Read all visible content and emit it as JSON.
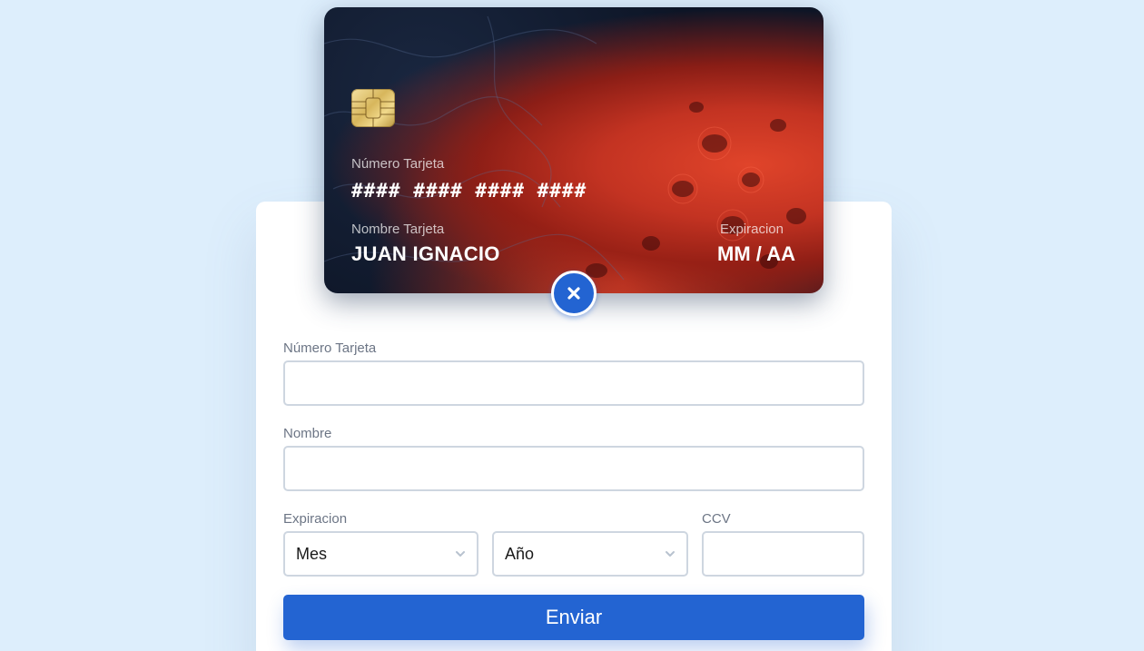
{
  "card": {
    "number_label": "Número Tarjeta",
    "number_value": "#### #### #### ####",
    "name_label": "Nombre Tarjeta",
    "name_value": "JUAN IGNACIO",
    "expiry_label": "Expiracion",
    "expiry_value": "MM / AA"
  },
  "toggle": {
    "icon": "close-icon"
  },
  "form": {
    "number_label": "Número Tarjeta",
    "number_value": "",
    "name_label": "Nombre",
    "name_value": "",
    "expiry_label": "Expiracion",
    "month_value": "Mes",
    "year_value": "Año",
    "ccv_label": "CCV",
    "ccv_value": "",
    "submit_label": "Enviar"
  },
  "colors": {
    "background": "#ddeefc",
    "accent": "#2364d2",
    "panel": "#ffffff"
  }
}
